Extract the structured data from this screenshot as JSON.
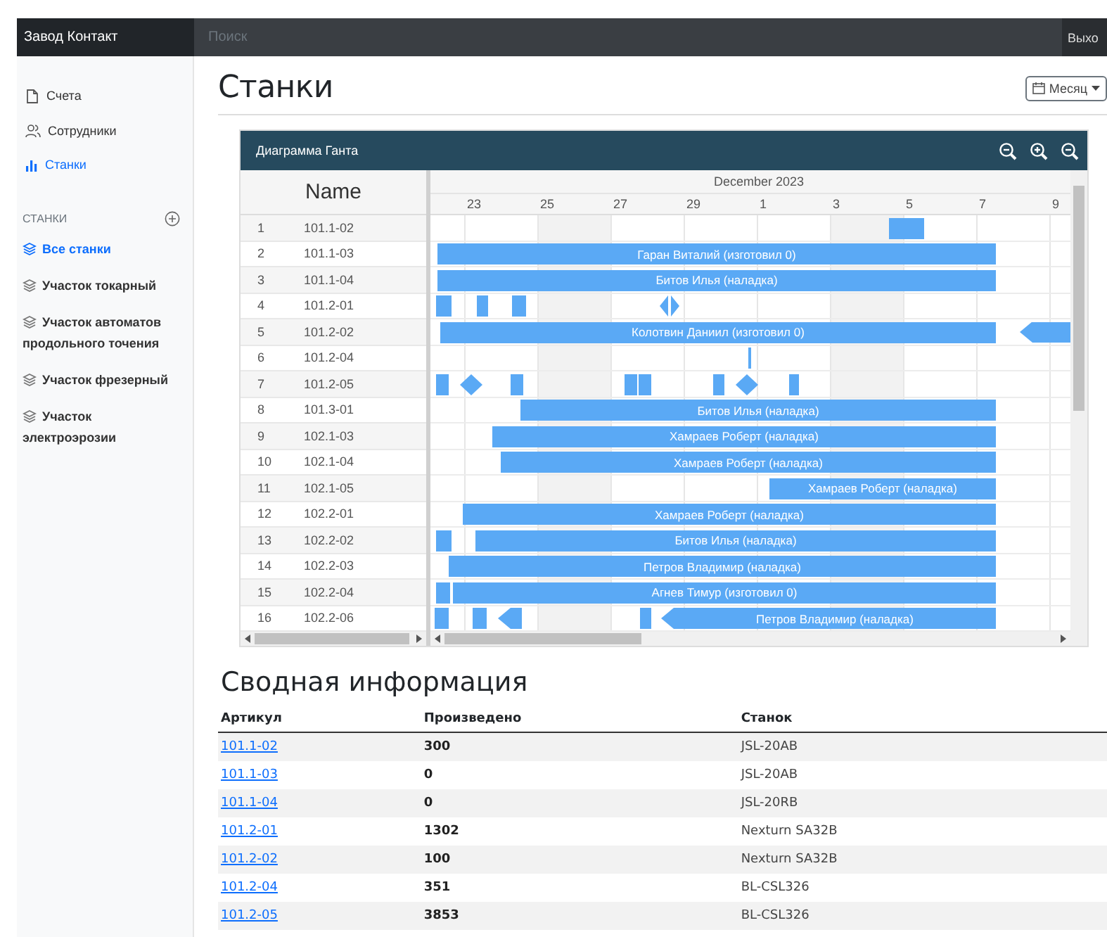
{
  "topbar": {
    "brand": "Завод Контакт",
    "search": {
      "placeholder": "Поиск"
    },
    "logout": "Выхо"
  },
  "sidebar": {
    "items": [
      {
        "label": "Счета",
        "selected": false
      },
      {
        "label": "Сотрудники",
        "selected": false
      },
      {
        "label": "Станки",
        "selected": true
      }
    ],
    "section": {
      "title": "СТАНКИ",
      "items": [
        {
          "label": "Все станки",
          "selected": true
        },
        {
          "label": "Участок токарный",
          "selected": false
        },
        {
          "label": "Участок автоматов продольного точения",
          "selected": false
        },
        {
          "label": "Участок фрезерный",
          "selected": false
        },
        {
          "label": "Участок электроэрозии",
          "selected": false
        }
      ]
    }
  },
  "page": {
    "title": "Станки",
    "month_button": "Месяц"
  },
  "gantt": {
    "title": "Диаграмма Ганта",
    "name_header": "Name",
    "month": "December 2023",
    "ticks": [
      {
        "label": "23",
        "shaded": false
      },
      {
        "label": "25",
        "shaded": true
      },
      {
        "label": "27",
        "shaded": false
      },
      {
        "label": "29",
        "shaded": false
      },
      {
        "label": "1",
        "shaded": false
      },
      {
        "label": "3",
        "shaded": true
      },
      {
        "label": "5",
        "shaded": false
      },
      {
        "label": "7",
        "shaded": false
      },
      {
        "label": "9",
        "shaded": false
      }
    ],
    "rows": [
      {
        "num": "1",
        "name": "101.1-02",
        "bars": [
          {
            "kind": "task"
          }
        ]
      },
      {
        "num": "2",
        "name": "101.1-03",
        "bars": [
          {
            "kind": "task",
            "label": "Гаран Виталий (изготовил 0)"
          }
        ]
      },
      {
        "num": "3",
        "name": "101.1-04",
        "bars": [
          {
            "kind": "task",
            "label": "Битов Илья (наладка)"
          }
        ]
      },
      {
        "num": "4",
        "name": "101.2-01",
        "bars": [
          {
            "kind": "task"
          },
          {
            "kind": "task"
          },
          {
            "kind": "task"
          },
          {
            "kind": "split-milestone"
          }
        ]
      },
      {
        "num": "5",
        "name": "101.2-02",
        "bars": [
          {
            "kind": "task",
            "label": "Колотвин Даниил (изготовил 0)"
          },
          {
            "kind": "pointed"
          }
        ]
      },
      {
        "num": "6",
        "name": "101.2-04",
        "bars": [
          {
            "kind": "task"
          }
        ]
      },
      {
        "num": "7",
        "name": "101.2-05",
        "bars": [
          {
            "kind": "task"
          },
          {
            "kind": "milestone"
          },
          {
            "kind": "task"
          },
          {
            "kind": "task"
          },
          {
            "kind": "task"
          },
          {
            "kind": "task"
          },
          {
            "kind": "milestone"
          },
          {
            "kind": "task"
          }
        ]
      },
      {
        "num": "8",
        "name": "101.3-01",
        "bars": [
          {
            "kind": "task",
            "label": "Битов Илья (наладка)"
          }
        ]
      },
      {
        "num": "9",
        "name": "102.1-03",
        "bars": [
          {
            "kind": "task",
            "label": "Хамраев Роберт (наладка)"
          }
        ]
      },
      {
        "num": "10",
        "name": "102.1-04",
        "bars": [
          {
            "kind": "task",
            "label": "Хамраев Роберт (наладка)"
          }
        ]
      },
      {
        "num": "11",
        "name": "102.1-05",
        "bars": [
          {
            "kind": "task",
            "label": "Хамраев Роберт (наладка)"
          }
        ]
      },
      {
        "num": "12",
        "name": "102.2-01",
        "bars": [
          {
            "kind": "task",
            "label": "Хамраев Роберт (наладка)"
          }
        ]
      },
      {
        "num": "13",
        "name": "102.2-02",
        "bars": [
          {
            "kind": "task"
          },
          {
            "kind": "task",
            "label": "Битов Илья (наладка)"
          }
        ]
      },
      {
        "num": "14",
        "name": "102.2-03",
        "bars": [
          {
            "kind": "task",
            "label": "Петров Владимир (наладка)"
          }
        ]
      },
      {
        "num": "15",
        "name": "102.2-04",
        "bars": [
          {
            "kind": "task"
          },
          {
            "kind": "task",
            "label": "Агнев Тимур (изготовил 0)"
          }
        ]
      },
      {
        "num": "16",
        "name": "102.2-06",
        "bars": [
          {
            "kind": "task"
          },
          {
            "kind": "task"
          },
          {
            "kind": "pointed"
          },
          {
            "kind": "task"
          },
          {
            "kind": "pointed",
            "label": "Петров Владимир (наладка)"
          }
        ]
      }
    ]
  },
  "summary": {
    "title": "Сводная информация",
    "columns": [
      "Артикул",
      "Произведено",
      "Станок"
    ],
    "rows": [
      {
        "article": "101.1-02",
        "produced": "300",
        "machine": "JSL-20AB"
      },
      {
        "article": "101.1-03",
        "produced": "0",
        "machine": "JSL-20AB"
      },
      {
        "article": "101.1-04",
        "produced": "0",
        "machine": "JSL-20RB"
      },
      {
        "article": "101.2-01",
        "produced": "1302",
        "machine": "Nexturn SA32B"
      },
      {
        "article": "101.2-02",
        "produced": "100",
        "machine": "Nexturn SA32B"
      },
      {
        "article": "101.2-04",
        "produced": "351",
        "machine": "BL-CSL326"
      },
      {
        "article": "101.2-05",
        "produced": "3853",
        "machine": "BL-CSL326"
      }
    ]
  }
}
